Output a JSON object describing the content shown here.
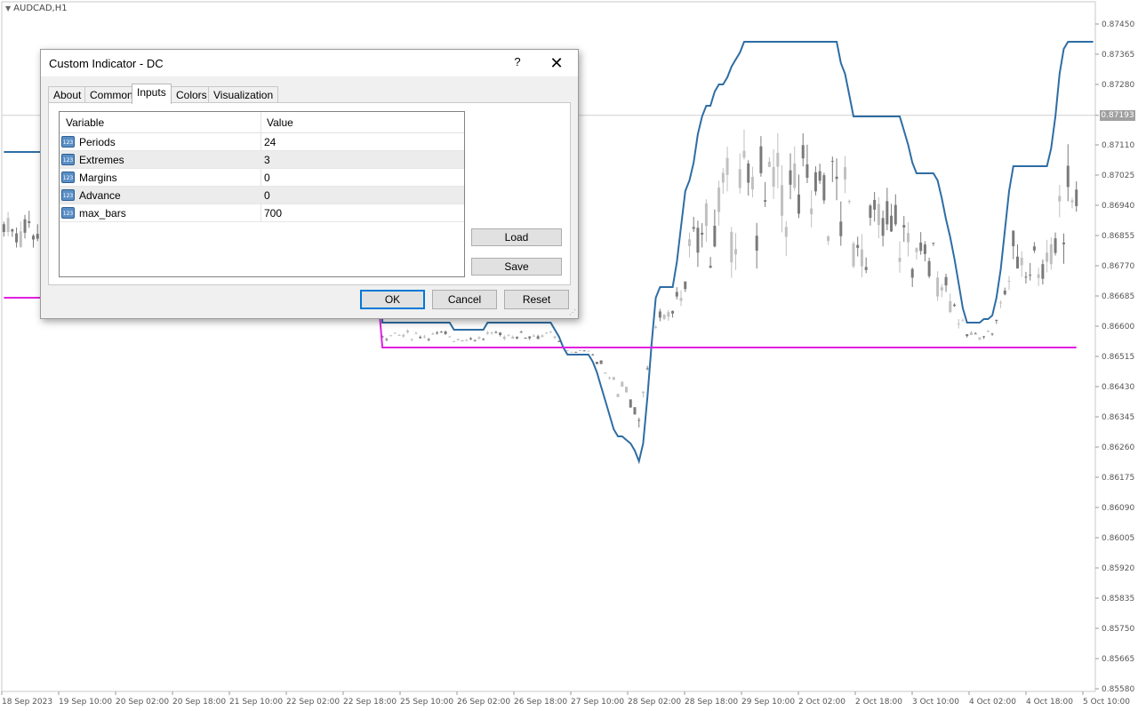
{
  "chart": {
    "symbol_title": "AUDCAD,H1",
    "current_price": "0.87193",
    "colors": {
      "upper_band": "#2e6da4",
      "lower_band": "#e020e0",
      "candle_bull": "#c0c0c0",
      "candle_bear": "#7a7a7a",
      "grid": "#d8d8d8"
    }
  },
  "chart_data": {
    "type": "line",
    "title": "AUDCAD,H1",
    "y_ticks": [
      "0.87450",
      "0.87365",
      "0.87280",
      "0.87193",
      "0.87110",
      "0.87025",
      "0.86940",
      "0.86855",
      "0.86770",
      "0.86685",
      "0.86600",
      "0.86515",
      "0.86430",
      "0.86345",
      "0.86260",
      "0.86175",
      "0.86090",
      "0.86005",
      "0.85920",
      "0.85835",
      "0.85750",
      "0.85665",
      "0.85580"
    ],
    "x_ticks": [
      "18 Sep 2023",
      "19 Sep 10:00",
      "20 Sep 02:00",
      "20 Sep 18:00",
      "21 Sep 10:00",
      "22 Sep 02:00",
      "22 Sep 18:00",
      "25 Sep 10:00",
      "26 Sep 02:00",
      "26 Sep 18:00",
      "27 Sep 10:00",
      "28 Sep 02:00",
      "28 Sep 18:00",
      "29 Sep 10:00",
      "2 Oct 02:00",
      "2 Oct 18:00",
      "3 Oct 10:00",
      "4 Oct 02:00",
      "4 Oct 18:00",
      "5 Oct 10:00"
    ],
    "ylim": [
      0.8555,
      0.875
    ],
    "series": [
      {
        "values": [
          0.8709,
          0.8709,
          0.8709,
          0.8709,
          0.8709,
          0.8709,
          0.8709,
          0.8709,
          0.8709,
          0.8709,
          0.8709,
          0.8709,
          0.8709,
          0.8709,
          0.8709,
          0.8709,
          0.8709,
          0.8709,
          0.8709,
          0.8709,
          0.8709,
          0.8709,
          0.8709,
          0.8709,
          0.8709,
          0.8709,
          0.8709,
          0.8709,
          0.8709,
          0.8709,
          0.8709,
          0.8709,
          0.8709,
          0.8709,
          0.8709,
          0.8709,
          0.8709,
          0.8709,
          0.8709,
          0.8709,
          0.8709,
          0.8709,
          0.8709,
          0.8709,
          0.8709,
          0.8709,
          0.8709,
          0.8709,
          0.8709,
          0.8709,
          0.8709,
          0.8709,
          0.8709,
          0.8709,
          0.8709,
          0.8709,
          0.8709,
          0.8709,
          0.8709,
          0.8709,
          0.8709,
          0.8709,
          0.8709,
          0.8709,
          0.8709,
          0.8709,
          0.8709,
          0.8709,
          0.8709,
          0.8709,
          0.8709,
          0.8709,
          0.8709,
          0.8709,
          0.8709,
          0.8709,
          0.8709,
          0.8709,
          0.8709,
          0.8709,
          0.8709,
          0.8709,
          0.8709,
          0.8709,
          0.8709,
          0.8709,
          0.8709,
          0.8709,
          0.8709,
          0.8709,
          0.8661,
          0.8661,
          0.8661,
          0.8661,
          0.8661,
          0.8661,
          0.8661,
          0.8661,
          0.8661,
          0.8661,
          0.8661,
          0.8661,
          0.8661,
          0.8661,
          0.8661,
          0.8661,
          0.8661,
          0.8659,
          0.8659,
          0.8659,
          0.8659,
          0.8659,
          0.8659,
          0.8659,
          0.8659,
          0.8661,
          0.8661,
          0.8661,
          0.8661,
          0.8661,
          0.8661,
          0.8661,
          0.8661,
          0.8661,
          0.8661,
          0.8661,
          0.8661,
          0.8661,
          0.8661,
          0.8661,
          0.8661,
          0.8659,
          0.8657,
          0.8654,
          0.8652,
          0.8652,
          0.8652,
          0.8652,
          0.8652,
          0.8652,
          0.865,
          0.8647,
          0.8643,
          0.8639,
          0.8635,
          0.8631,
          0.8629,
          0.8629,
          0.8628,
          0.8627,
          0.8625,
          0.8622,
          0.8627,
          0.864,
          0.8655,
          0.8668,
          0.8671,
          0.8671,
          0.8671,
          0.8671,
          0.8678,
          0.8688,
          0.8698,
          0.8701,
          0.8706,
          0.8714,
          0.8719,
          0.8722,
          0.8722,
          0.8726,
          0.8728,
          0.8728,
          0.873,
          0.8733,
          0.8735,
          0.8737,
          0.874,
          0.874,
          0.874,
          0.874,
          0.874,
          0.874,
          0.874,
          0.874,
          0.874,
          0.874,
          0.874,
          0.874,
          0.874,
          0.874,
          0.874,
          0.874,
          0.874,
          0.874,
          0.874,
          0.874,
          0.874,
          0.874,
          0.874,
          0.8734,
          0.8731,
          0.8725,
          0.8719,
          0.8719,
          0.8719,
          0.8719,
          0.8719,
          0.8719,
          0.8719,
          0.8719,
          0.8719,
          0.8719,
          0.8719,
          0.8719,
          0.8715,
          0.8711,
          0.8706,
          0.8703,
          0.8703,
          0.8703,
          0.8703,
          0.8703,
          0.8701,
          0.8696,
          0.869,
          0.8685,
          0.8679,
          0.8672,
          0.8665,
          0.8661,
          0.8661,
          0.8661,
          0.8661,
          0.8662,
          0.8662,
          0.8663,
          0.8668,
          0.8676,
          0.8687,
          0.8698,
          0.8705,
          0.8705,
          0.8705,
          0.8705,
          0.8705,
          0.8705,
          0.8705,
          0.8705,
          0.8705,
          0.871,
          0.8719,
          0.8731,
          0.8738,
          0.874,
          0.874,
          0.874,
          0.874,
          0.874,
          0.874,
          0.874
        ]
      },
      {
        "values": [
          0.8668,
          0.8668,
          0.8668,
          0.8668,
          0.8668,
          0.8668,
          0.8668,
          0.8668,
          0.8668,
          0.8668,
          0.8668,
          0.8668,
          0.8668,
          0.8668,
          0.8668,
          0.8668,
          0.8668,
          0.8668,
          0.8668,
          0.8668,
          0.8668,
          0.8668,
          0.8668,
          0.8668,
          0.8668,
          0.8668,
          0.8668,
          0.8668,
          0.8668,
          0.8668,
          0.8668,
          0.8668,
          0.8668,
          0.8668,
          0.8668,
          0.8668,
          0.8668,
          0.8668,
          0.8668,
          0.8668,
          0.8668,
          0.8668,
          0.8668,
          0.8668,
          0.8668,
          0.8668,
          0.8668,
          0.8668,
          0.8668,
          0.8668,
          0.8668,
          0.8668,
          0.8668,
          0.8668,
          0.8668,
          0.8668,
          0.8668,
          0.8668,
          0.8668,
          0.8668,
          0.8668,
          0.8668,
          0.8668,
          0.8668,
          0.8668,
          0.8668,
          0.8668,
          0.8668,
          0.8668,
          0.8668,
          0.8668,
          0.8668,
          0.8668,
          0.8668,
          0.8668,
          0.8668,
          0.8668,
          0.8668,
          0.8668,
          0.8668,
          0.8668,
          0.8668,
          0.8668,
          0.8668,
          0.8668,
          0.8668,
          0.8668,
          0.8668,
          0.8668,
          0.8668,
          0.8654,
          0.8654,
          0.8654,
          0.8654,
          0.8654,
          0.8654,
          0.8654,
          0.8654,
          0.8654,
          0.8654,
          0.8654,
          0.8654,
          0.8654,
          0.8654,
          0.8654,
          0.8654,
          0.8654,
          0.8654,
          0.8654,
          0.8654,
          0.8654,
          0.8654,
          0.8654,
          0.8654,
          0.8654,
          0.8654,
          0.8654,
          0.8654,
          0.8654,
          0.8654,
          0.8654,
          0.8654,
          0.8654,
          0.8654,
          0.8654,
          0.8654,
          0.8654,
          0.8654,
          0.8654,
          0.8654,
          0.8654,
          0.8654,
          0.8654,
          0.8654,
          0.8654,
          0.8654,
          0.8654,
          0.8654,
          0.8654,
          0.8654,
          0.8654,
          0.8654,
          0.8654,
          0.8654,
          0.8654,
          0.8654,
          0.8654,
          0.8654,
          0.8654,
          0.8654,
          0.8654,
          0.8654,
          0.8654,
          0.8654,
          0.8654,
          0.8654,
          0.8654,
          0.8654,
          0.8654,
          0.8654,
          0.8654,
          0.8654,
          0.8654,
          0.8654,
          0.8654,
          0.8654,
          0.8654,
          0.8654,
          0.8654,
          0.8654,
          0.8654,
          0.8654,
          0.8654,
          0.8654,
          0.8654,
          0.8654,
          0.8654,
          0.8654,
          0.8654,
          0.8654,
          0.8654,
          0.8654,
          0.8654,
          0.8654,
          0.8654,
          0.8654,
          0.8654,
          0.8654,
          0.8654,
          0.8654,
          0.8654,
          0.8654,
          0.8654,
          0.8654,
          0.8654,
          0.8654,
          0.8654,
          0.8654,
          0.8654,
          0.8654,
          0.8654,
          0.8654,
          0.8654,
          0.8654,
          0.8654,
          0.8654,
          0.8654,
          0.8654,
          0.8654,
          0.8654,
          0.8654,
          0.8654,
          0.8654,
          0.8654,
          0.8654,
          0.8654,
          0.8654,
          0.8654,
          0.8654,
          0.8654,
          0.8654,
          0.8654,
          0.8654,
          0.8654,
          0.8654,
          0.8654,
          0.8654,
          0.8654,
          0.8654,
          0.8654,
          0.8654,
          0.8654,
          0.8654,
          0.8654,
          0.8654,
          0.8654,
          0.8654,
          0.8654,
          0.8654,
          0.8654,
          0.8654,
          0.8654,
          0.8654,
          0.8654,
          0.8654,
          0.8654,
          0.8654,
          0.8654,
          0.8654,
          0.8654,
          0.8654,
          0.8654,
          0.8654,
          0.8654,
          0.8654,
          0.8654
        ]
      }
    ],
    "grid": false
  },
  "dialog": {
    "title": "Custom Indicator - DC",
    "help_label": "?",
    "close_label": "✕",
    "tabs": [
      {
        "label": "About"
      },
      {
        "label": "Common"
      },
      {
        "label": "Inputs"
      },
      {
        "label": "Colors"
      },
      {
        "label": "Visualization"
      }
    ],
    "active_tab": "Inputs",
    "columns": {
      "variable": "Variable",
      "value": "Value"
    },
    "rows": [
      {
        "name": "Periods",
        "value": "24"
      },
      {
        "name": "Extremes",
        "value": "3"
      },
      {
        "name": "Margins",
        "value": "0"
      },
      {
        "name": "Advance",
        "value": "0"
      },
      {
        "name": "max_bars",
        "value": "700"
      }
    ],
    "param_icon_text": "123",
    "load_label": "Load",
    "save_label": "Save",
    "ok_label": "OK",
    "cancel_label": "Cancel",
    "reset_label": "Reset"
  }
}
